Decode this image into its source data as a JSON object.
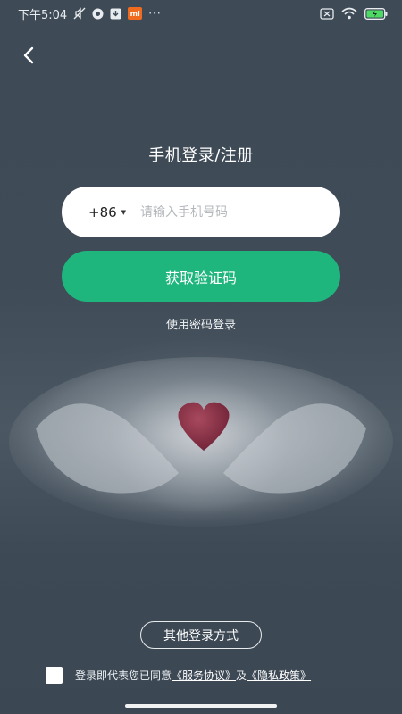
{
  "status_bar": {
    "time": "下午5:04",
    "mi_badge": "mi",
    "more": "···"
  },
  "page": {
    "title": "手机登录/注册"
  },
  "phone": {
    "country_code": "+86",
    "placeholder": "请输入手机号码",
    "value": ""
  },
  "buttons": {
    "get_code": "获取验证码",
    "password_login": "使用密码登录",
    "other_login": "其他登录方式"
  },
  "agreement": {
    "prefix": "登录即代表您已同意",
    "service": "《服务协议》",
    "and": "及",
    "privacy": "《隐私政策》",
    "checked": false
  },
  "colors": {
    "background": "#3f4b56",
    "accent": "#1fb67e",
    "heart": "#8b2f44"
  }
}
